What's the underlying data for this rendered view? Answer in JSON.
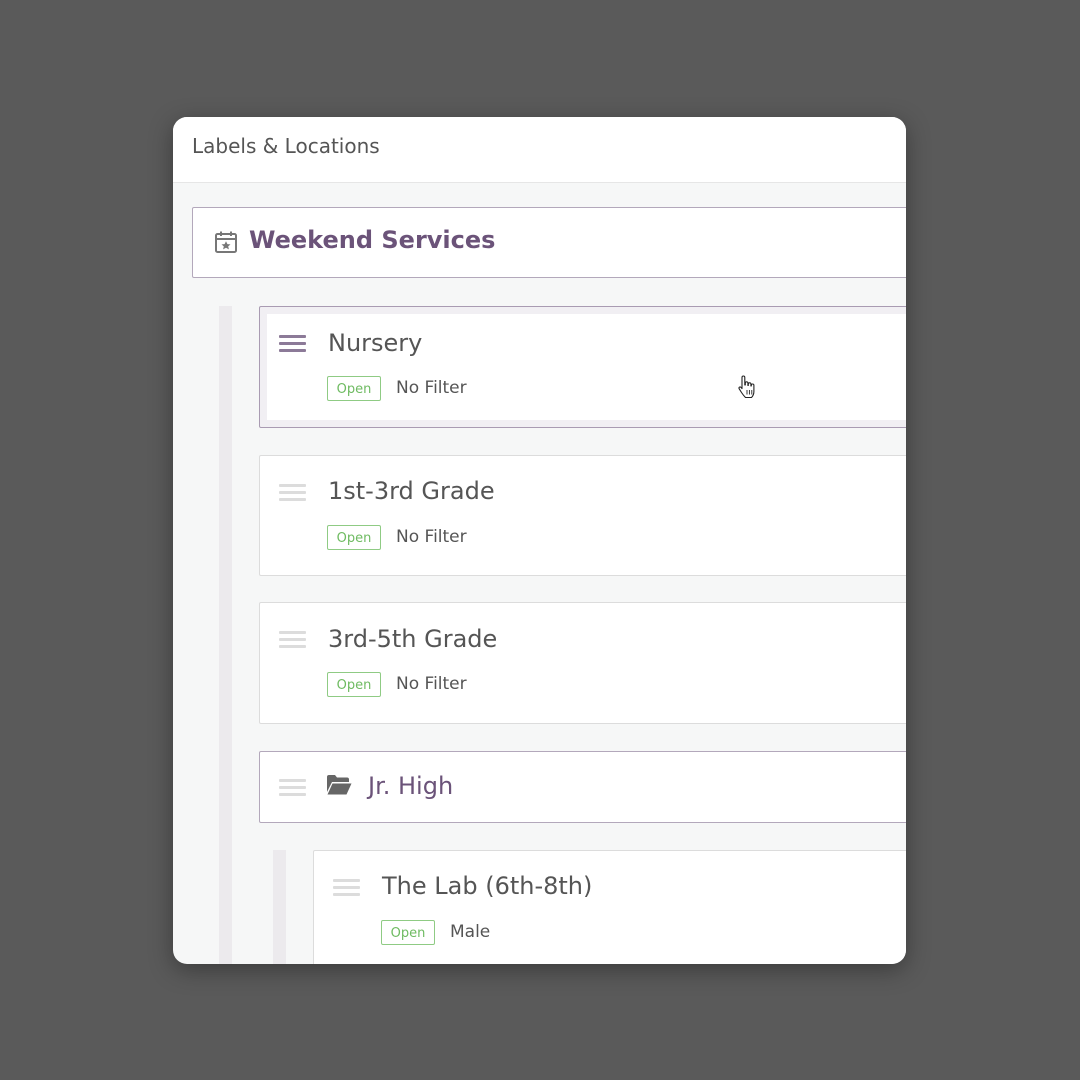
{
  "window": {
    "title": "Labels & Locations"
  },
  "group": {
    "title": "Weekend Services",
    "icon": "calendar-star-icon"
  },
  "locations": [
    {
      "name": "Nursery",
      "status": "Open",
      "filter": "No Filter",
      "selected": true
    },
    {
      "name": "1st-3rd Grade",
      "status": "Open",
      "filter": "No Filter"
    },
    {
      "name": "3rd-5th Grade",
      "status": "Open",
      "filter": "No Filter"
    }
  ],
  "subgroup": {
    "name": "Jr. High",
    "icon": "folder-open-icon",
    "locations": [
      {
        "name": "The Lab (6th-8th)",
        "status": "Open",
        "filter": "Male"
      }
    ]
  },
  "colors": {
    "accent": "#6b5379",
    "open_badge": "#6fbb62",
    "backdrop": "#5a5a5a"
  }
}
